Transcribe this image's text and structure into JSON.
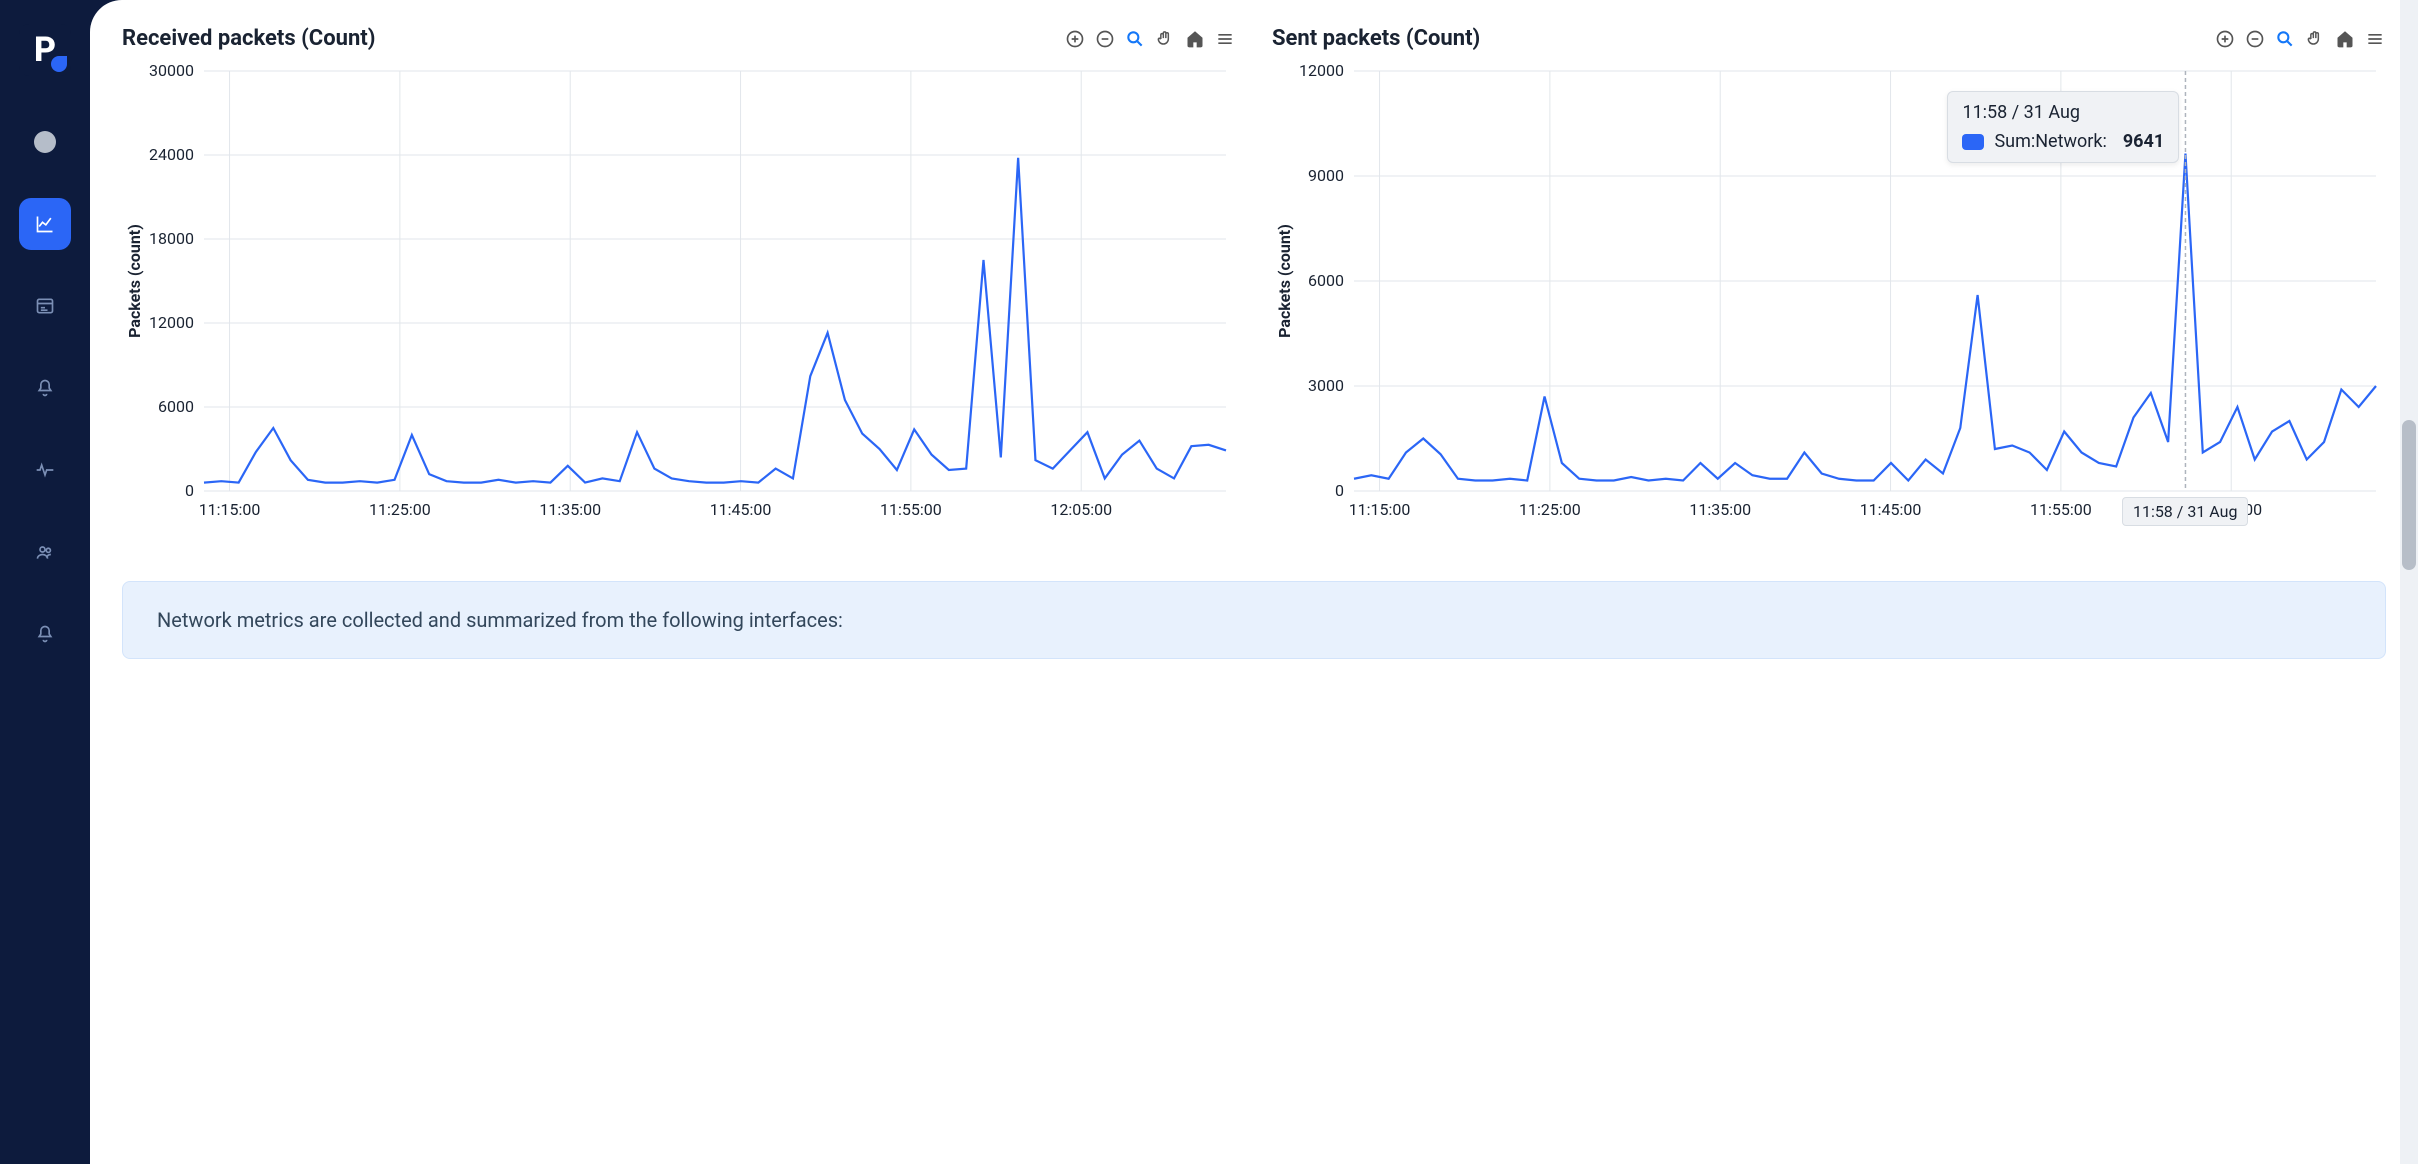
{
  "sidebar": {
    "logo_letter": "P"
  },
  "charts": {
    "received": {
      "title": "Received packets (Count)",
      "ylabel": "Packets (count)"
    },
    "sent": {
      "title": "Sent packets (Count)",
      "ylabel": "Packets (count)"
    }
  },
  "tooltip": {
    "time": "11:58 / 31 Aug",
    "series_label": "Sum:Network:",
    "value": "9641",
    "x_tag": "11:58 / 31 Aug"
  },
  "banner": {
    "text": "Network metrics are collected and summarized from the following interfaces:"
  },
  "colors": {
    "primary": "#2b66f6",
    "accent": "#1477f8",
    "bg_dark": "#0d1b3d"
  },
  "chart_data": [
    {
      "type": "line",
      "title": "Received packets (Count)",
      "xlabel": "",
      "ylabel": "Packets (count)",
      "ylim": [
        0,
        30000
      ],
      "y_ticks": [
        0,
        6000,
        12000,
        18000,
        24000,
        30000
      ],
      "x_ticks": [
        "11:15:00",
        "11:25:00",
        "11:35:00",
        "11:45:00",
        "11:55:00",
        "12:05:00"
      ],
      "series": [
        {
          "name": "Sum:Network",
          "x": [
            "11:10",
            "11:11",
            "11:12",
            "11:13",
            "11:14",
            "11:15",
            "11:16",
            "11:17",
            "11:18",
            "11:19",
            "11:20",
            "11:21",
            "11:22",
            "11:23",
            "11:24",
            "11:25",
            "11:26",
            "11:27",
            "11:28",
            "11:29",
            "11:30",
            "11:31",
            "11:32",
            "11:33",
            "11:34",
            "11:35",
            "11:36",
            "11:37",
            "11:38",
            "11:39",
            "11:40",
            "11:41",
            "11:42",
            "11:43",
            "11:44",
            "11:45",
            "11:46",
            "11:47",
            "11:48",
            "11:49",
            "11:50",
            "11:51",
            "11:52",
            "11:53",
            "11:54",
            "11:55",
            "11:56",
            "11:57",
            "11:58",
            "11:59",
            "12:00",
            "12:01",
            "12:02",
            "12:03",
            "12:04",
            "12:05",
            "12:06",
            "12:07",
            "12:08",
            "12:09"
          ],
          "values": [
            600,
            700,
            600,
            2800,
            4500,
            2200,
            800,
            600,
            600,
            700,
            600,
            800,
            4000,
            1200,
            700,
            600,
            600,
            800,
            600,
            700,
            600,
            1800,
            600,
            900,
            700,
            4200,
            1600,
            900,
            700,
            600,
            600,
            700,
            600,
            1600,
            900,
            8200,
            11300,
            6500,
            4100,
            3000,
            1500,
            4400,
            2600,
            1500,
            1600,
            16500,
            2400,
            23800,
            2200,
            1600,
            2900,
            4200,
            900,
            2600,
            3600,
            1600,
            900,
            3200,
            3300,
            2900
          ]
        }
      ]
    },
    {
      "type": "line",
      "title": "Sent packets (Count)",
      "xlabel": "",
      "ylabel": "Packets (count)",
      "ylim": [
        0,
        12000
      ],
      "y_ticks": [
        0,
        3000,
        6000,
        9000,
        12000
      ],
      "x_ticks": [
        "11:15:00",
        "11:25:00",
        "11:35:00",
        "11:45:00",
        "11:55:00",
        "12:05:00"
      ],
      "tooltip_point": {
        "x": "11:58",
        "date": "31 Aug",
        "series": "Sum:Network",
        "value": 9641
      },
      "series": [
        {
          "name": "Sum:Network",
          "x": [
            "11:10",
            "11:11",
            "11:12",
            "11:13",
            "11:14",
            "11:15",
            "11:16",
            "11:17",
            "11:18",
            "11:19",
            "11:20",
            "11:21",
            "11:22",
            "11:23",
            "11:24",
            "11:25",
            "11:26",
            "11:27",
            "11:28",
            "11:29",
            "11:30",
            "11:31",
            "11:32",
            "11:33",
            "11:34",
            "11:35",
            "11:36",
            "11:37",
            "11:38",
            "11:39",
            "11:40",
            "11:41",
            "11:42",
            "11:43",
            "11:44",
            "11:45",
            "11:46",
            "11:47",
            "11:48",
            "11:49",
            "11:50",
            "11:51",
            "11:52",
            "11:53",
            "11:54",
            "11:55",
            "11:56",
            "11:57",
            "11:58",
            "11:59",
            "12:00",
            "12:01",
            "12:02",
            "12:03",
            "12:04",
            "12:05",
            "12:06",
            "12:07",
            "12:08",
            "12:09"
          ],
          "values": [
            350,
            450,
            350,
            1100,
            1500,
            1050,
            350,
            300,
            300,
            350,
            300,
            2700,
            800,
            350,
            300,
            300,
            400,
            300,
            350,
            300,
            800,
            350,
            800,
            450,
            350,
            350,
            1100,
            500,
            350,
            300,
            300,
            800,
            300,
            900,
            500,
            1800,
            5600,
            1200,
            1300,
            1100,
            600,
            1700,
            1100,
            800,
            700,
            2100,
            2800,
            1400,
            9641,
            1100,
            1400,
            2400,
            900,
            1700,
            2000,
            900,
            1400,
            2900,
            2400,
            3000
          ]
        }
      ]
    }
  ]
}
